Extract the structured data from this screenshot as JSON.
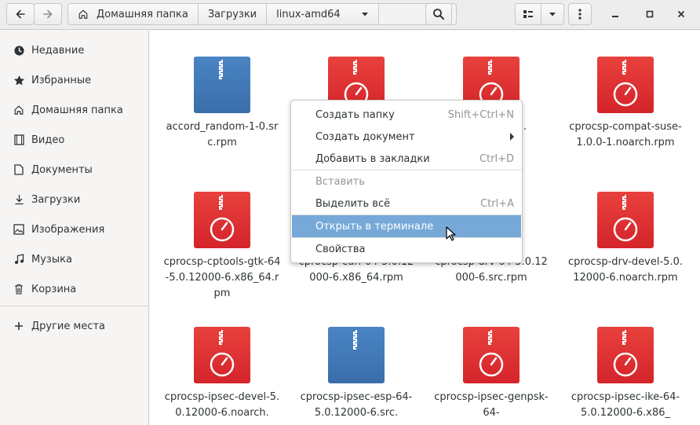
{
  "header": {
    "back_icon": "arrow-left-icon",
    "forward_icon": "arrow-right-icon",
    "home_icon": "home-icon",
    "breadcrumbs": [
      "Домашняя папка",
      "Загрузки",
      "linux-amd64"
    ],
    "search_icon": "search-icon",
    "view_icon": "list-view-icon",
    "menu_icon": "kebab-menu-icon",
    "window_controls": [
      "minimize-icon",
      "maximize-icon",
      "close-icon"
    ]
  },
  "sidebar": {
    "items": [
      {
        "label": "Недавние",
        "icon": "clock-icon"
      },
      {
        "label": "Избранные",
        "icon": "star-icon"
      },
      {
        "label": "Домашняя папка",
        "icon": "home-icon"
      },
      {
        "label": "Видео",
        "icon": "film-icon"
      },
      {
        "label": "Документы",
        "icon": "document-icon"
      },
      {
        "label": "Загрузки",
        "icon": "download-icon"
      },
      {
        "label": "Изображения",
        "icon": "image-icon"
      },
      {
        "label": "Музыка",
        "icon": "music-icon"
      },
      {
        "label": "Корзина",
        "icon": "trash-icon"
      }
    ],
    "other_places": {
      "label": "Другие места",
      "icon": "plus-icon"
    }
  },
  "files": [
    {
      "name": "accord_random-1-0.src.rpm",
      "color": "blue"
    },
    {
      "name": "",
      "color": "red"
    },
    {
      "name": "at-1.",
      "color": "red"
    },
    {
      "name": "cprocsp-compat-suse-1.0.0-1.noarch.rpm",
      "color": "red"
    },
    {
      "name": "cprocsp-cptools-gtk-64-5.0.12000-6.x86_64.rpm",
      "color": "red"
    },
    {
      "name": "cprocsp-curl-64-5.0.12000-6.x86_64.rpm",
      "color": "red"
    },
    {
      "name": "cprocsp-drv-64-5.0.12000-6.src.rpm",
      "color": "red"
    },
    {
      "name": "cprocsp-drv-devel-5.0.12000-6.noarch.rpm",
      "color": "red"
    },
    {
      "name": "cprocsp-ipsec-devel-5.0.12000-6.noarch.",
      "color": "red"
    },
    {
      "name": "cprocsp-ipsec-esp-64-5.0.12000-6.src.",
      "color": "blue"
    },
    {
      "name": "cprocsp-ipsec-genpsk-64-",
      "color": "red"
    },
    {
      "name": "cprocsp-ipsec-ike-64-5.0.12000-6.x86_",
      "color": "red"
    }
  ],
  "context_menu": {
    "items": [
      {
        "label": "Создать папку",
        "accel": "Shift+Ctrl+N"
      },
      {
        "label": "Создать документ",
        "accel": ""
      },
      {
        "label": "Добавить в закладки",
        "accel": "Ctrl+D"
      },
      {
        "label": "Вставить",
        "accel": "",
        "disabled": true
      },
      {
        "label": "Выделить всё",
        "accel": "Ctrl+A"
      },
      {
        "label": "Открыть в терминале",
        "accel": "",
        "highlighted": true
      },
      {
        "label": "Свойства",
        "accel": ""
      }
    ]
  },
  "colors": {
    "accent_highlight": "#77a9d8",
    "file_red": "#d4242a",
    "file_blue": "#3a6eaa"
  }
}
